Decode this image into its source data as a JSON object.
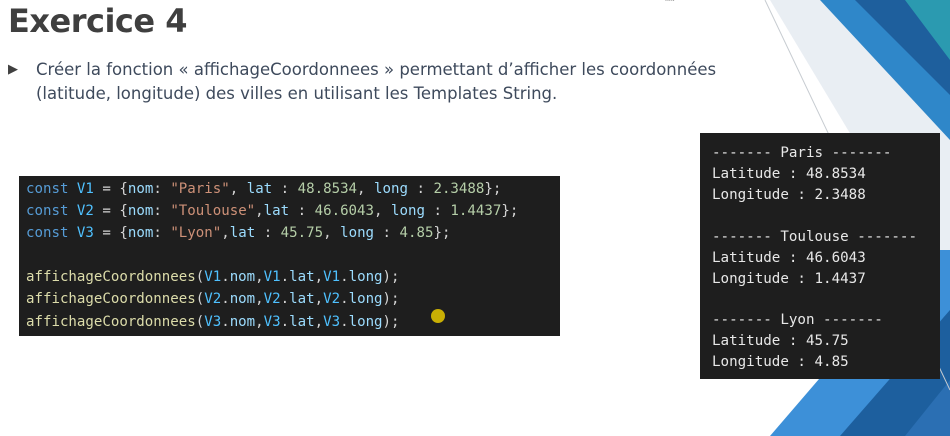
{
  "slide": {
    "title": "Exercice 4",
    "bullet_glyph": "▶",
    "bullet_text_line1": "Créer la fonction « affichageCoordonnees » permettant d’afficher les coordonnées",
    "bullet_text_line2": "(latitude, longitude) des villes en utilisant les Templates String.",
    "colors": {
      "title": "#3f3f3f",
      "body_text": "#3e4a5c",
      "accent_blue_dark": "#1f5f9e",
      "accent_blue_light": "#3c8fd6",
      "accent_teal": "#2e8b9a",
      "code_background": "#1e1e1e"
    }
  },
  "code": {
    "lines": [
      [
        {
          "t": "const ",
          "c": "kw"
        },
        {
          "t": "V1",
          "c": "var"
        },
        {
          "t": " = {",
          "c": "pun"
        },
        {
          "t": "nom",
          "c": "prop"
        },
        {
          "t": ": ",
          "c": "pun"
        },
        {
          "t": "\"Paris\"",
          "c": "str"
        },
        {
          "t": ", ",
          "c": "pun"
        },
        {
          "t": "lat",
          "c": "prop"
        },
        {
          "t": " : ",
          "c": "pun"
        },
        {
          "t": "48.8534",
          "c": "num"
        },
        {
          "t": ", ",
          "c": "pun"
        },
        {
          "t": "long",
          "c": "prop"
        },
        {
          "t": " : ",
          "c": "pun"
        },
        {
          "t": "2.3488",
          "c": "num"
        },
        {
          "t": "};",
          "c": "pun"
        }
      ],
      [
        {
          "t": "const ",
          "c": "kw"
        },
        {
          "t": "V2",
          "c": "var"
        },
        {
          "t": " = {",
          "c": "pun"
        },
        {
          "t": "nom",
          "c": "prop"
        },
        {
          "t": ": ",
          "c": "pun"
        },
        {
          "t": "\"Toulouse\"",
          "c": "str"
        },
        {
          "t": ",",
          "c": "pun"
        },
        {
          "t": "lat",
          "c": "prop"
        },
        {
          "t": " : ",
          "c": "pun"
        },
        {
          "t": "46.6043",
          "c": "num"
        },
        {
          "t": ", ",
          "c": "pun"
        },
        {
          "t": "long",
          "c": "prop"
        },
        {
          "t": " : ",
          "c": "pun"
        },
        {
          "t": "1.4437",
          "c": "num"
        },
        {
          "t": "};",
          "c": "pun"
        }
      ],
      [
        {
          "t": "const ",
          "c": "kw"
        },
        {
          "t": "V3",
          "c": "var"
        },
        {
          "t": " = {",
          "c": "pun"
        },
        {
          "t": "nom",
          "c": "prop"
        },
        {
          "t": ": ",
          "c": "pun"
        },
        {
          "t": "\"Lyon\"",
          "c": "str"
        },
        {
          "t": ",",
          "c": "pun"
        },
        {
          "t": "lat",
          "c": "prop"
        },
        {
          "t": " : ",
          "c": "pun"
        },
        {
          "t": "45.75",
          "c": "num"
        },
        {
          "t": ", ",
          "c": "pun"
        },
        {
          "t": "long",
          "c": "prop"
        },
        {
          "t": " : ",
          "c": "pun"
        },
        {
          "t": "4.85",
          "c": "num"
        },
        {
          "t": "};",
          "c": "pun"
        }
      ],
      [],
      [
        {
          "t": "affichageCoordonnees",
          "c": "fn"
        },
        {
          "t": "(",
          "c": "pun"
        },
        {
          "t": "V1",
          "c": "var"
        },
        {
          "t": ".",
          "c": "pun"
        },
        {
          "t": "nom",
          "c": "prop"
        },
        {
          "t": ",",
          "c": "pun"
        },
        {
          "t": "V1",
          "c": "var"
        },
        {
          "t": ".",
          "c": "pun"
        },
        {
          "t": "lat",
          "c": "prop"
        },
        {
          "t": ",",
          "c": "pun"
        },
        {
          "t": "V1",
          "c": "var"
        },
        {
          "t": ".",
          "c": "pun"
        },
        {
          "t": "long",
          "c": "prop"
        },
        {
          "t": ");",
          "c": "pun"
        }
      ],
      [
        {
          "t": "affichageCoordonnees",
          "c": "fn"
        },
        {
          "t": "(",
          "c": "pun"
        },
        {
          "t": "V2",
          "c": "var"
        },
        {
          "t": ".",
          "c": "pun"
        },
        {
          "t": "nom",
          "c": "prop"
        },
        {
          "t": ",",
          "c": "pun"
        },
        {
          "t": "V2",
          "c": "var"
        },
        {
          "t": ".",
          "c": "pun"
        },
        {
          "t": "lat",
          "c": "prop"
        },
        {
          "t": ",",
          "c": "pun"
        },
        {
          "t": "V2",
          "c": "var"
        },
        {
          "t": ".",
          "c": "pun"
        },
        {
          "t": "long",
          "c": "prop"
        },
        {
          "t": ");",
          "c": "pun"
        }
      ],
      [
        {
          "t": "affichageCoordonnees",
          "c": "fn"
        },
        {
          "t": "(",
          "c": "pun"
        },
        {
          "t": "V3",
          "c": "var"
        },
        {
          "t": ".",
          "c": "pun"
        },
        {
          "t": "nom",
          "c": "prop"
        },
        {
          "t": ",",
          "c": "pun"
        },
        {
          "t": "V3",
          "c": "var"
        },
        {
          "t": ".",
          "c": "pun"
        },
        {
          "t": "lat",
          "c": "prop"
        },
        {
          "t": ",",
          "c": "pun"
        },
        {
          "t": "V3",
          "c": "var"
        },
        {
          "t": ".",
          "c": "pun"
        },
        {
          "t": "long",
          "c": "prop"
        },
        {
          "t": ");",
          "c": "pun"
        }
      ]
    ]
  },
  "console": {
    "lines": [
      "------- Paris -------",
      "Latitude : 48.8534",
      "Longitude : 2.3488",
      "",
      "------- Toulouse -------",
      "Latitude : 46.6043",
      "Longitude : 1.4437",
      "",
      "------- Lyon -------",
      "Latitude : 45.75",
      "Longitude : 4.85"
    ]
  }
}
